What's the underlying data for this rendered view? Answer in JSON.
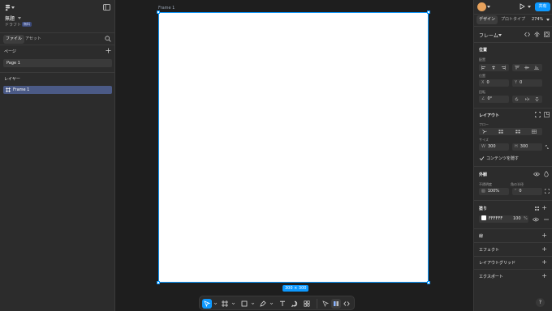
{
  "left_panel": {
    "project_name": "無題",
    "draft_label": "ドラフト",
    "badge": "無料",
    "tabs": [
      "ファイル",
      "アセット"
    ],
    "pages_title": "ページ",
    "pages": [
      {
        "label": "Page 1"
      }
    ],
    "layers_title": "レイヤー",
    "layers": [
      {
        "label": "Frame 1"
      }
    ]
  },
  "canvas": {
    "frame_name": "Frame 1",
    "size_label": "300 × 300",
    "background": "#1e1e1e",
    "selection_color": "#0d99ff"
  },
  "right_panel": {
    "share_label": "共有",
    "tabs": [
      "デザイン",
      "プロトタイプ"
    ],
    "zoom": "274%",
    "frame_type": "フレーム",
    "position": {
      "title": "位置",
      "align_label": "配置",
      "position_label": "位置",
      "x_prefix": "X",
      "x": "0",
      "y_prefix": "Y",
      "y": "0",
      "rotation_label": "回転",
      "rotation": "0°"
    },
    "layout": {
      "title": "レイアウト",
      "flow_label": "フロー",
      "size_label": "サイズ",
      "w_prefix": "W",
      "w": "300",
      "h_prefix": "H",
      "h": "300",
      "clip": "コンテンツを隠す"
    },
    "appearance": {
      "title": "外観",
      "opacity_label": "不透明度",
      "opacity": "100%",
      "radius_label": "角の半径",
      "radius": "0"
    },
    "fill": {
      "title": "塗り",
      "color": "FFFFFF",
      "opacity": "100",
      "unit": "%"
    },
    "sections": [
      "線",
      "エフェクト",
      "レイアウトグリッド",
      "エクスポート"
    ],
    "help": "?"
  },
  "toolbar": {
    "tools": [
      "move-tool",
      "frame-tool",
      "shape-tool",
      "pen-tool",
      "text-tool",
      "comment-tool",
      "actions-tool",
      "dev-mode-toggle",
      "code-view-toggle"
    ]
  }
}
